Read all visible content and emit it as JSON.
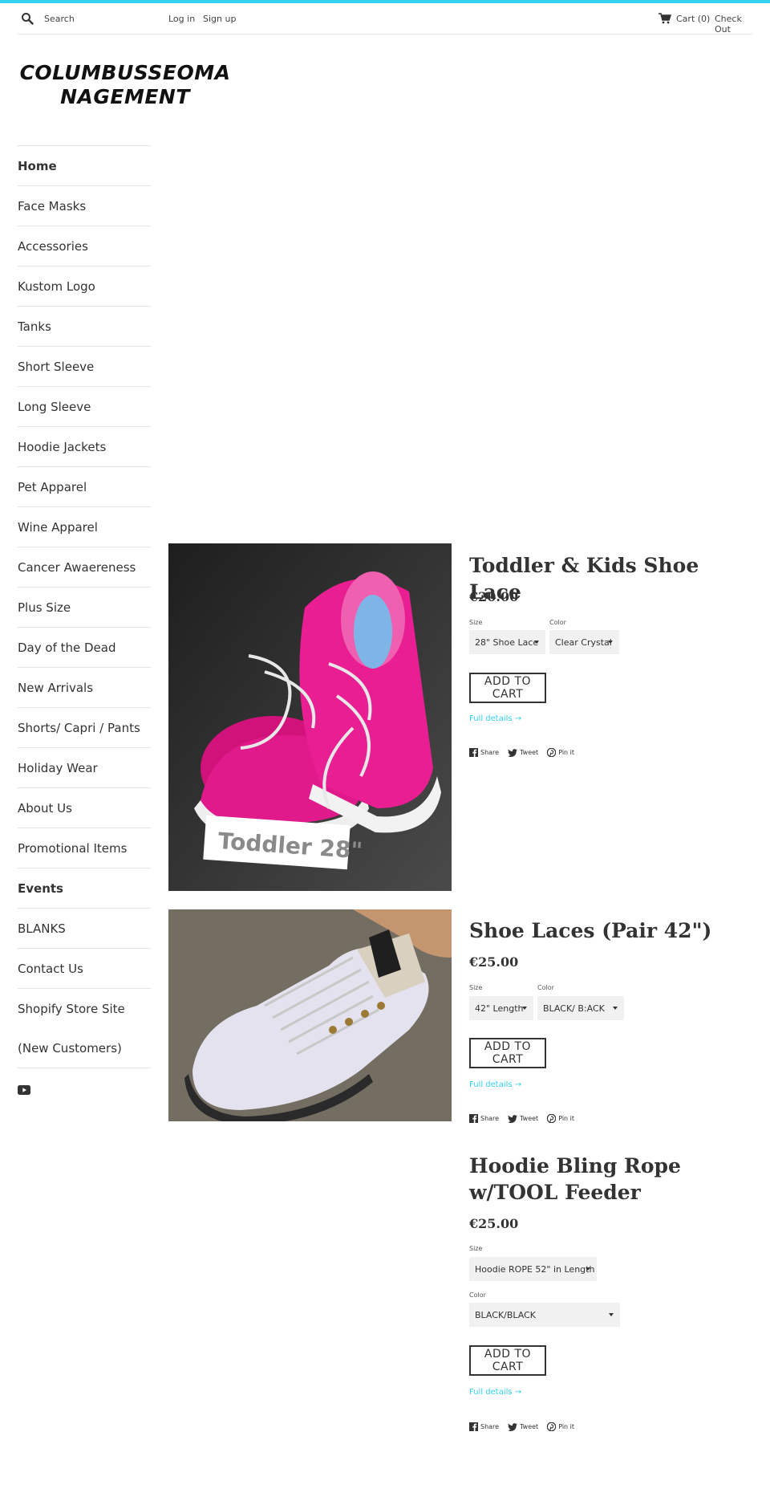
{
  "header": {
    "search_placeholder": "Search",
    "login": "Log in",
    "signup": "Sign up",
    "cart": "Cart (0)",
    "checkout": "Check Out"
  },
  "logo": {
    "line1": "COLUMBUSSEOMA",
    "line2": "NAGEMENT"
  },
  "nav": [
    "Home",
    "Face Masks",
    "Accessories",
    "Kustom Logo",
    "Tanks",
    "Short Sleeve",
    "Long Sleeve",
    "Hoodie Jackets",
    "Pet Apparel",
    "Wine Apparel",
    "Cancer Awaereness",
    "Plus Size",
    "Day of the Dead",
    "New Arrivals",
    "Shorts/ Capri / Pants",
    "Holiday Wear",
    "About Us",
    "Promotional Items",
    "Events",
    "BLANKS",
    "Contact Us",
    "Shopify Store Site",
    "(New Customers)"
  ],
  "products": [
    {
      "title": "Toddler & Kids Shoe Lace",
      "price": "€20.00",
      "image_text": "Toddler 28\"",
      "size_label": "Size",
      "size_value": "28\" Shoe Lace",
      "color_label": "Color",
      "color_value": "Clear Crystal",
      "cart": "ADD TO CART",
      "details": "Full details →"
    },
    {
      "title": "Shoe Laces (Pair 42\")",
      "price": "€25.00",
      "size_label": "Size",
      "size_value": "42\" Length",
      "color_label": "Color",
      "color_value": "BLACK/ B:ACK",
      "cart": "ADD TO CART",
      "details": "Full details →"
    },
    {
      "title": "Hoodie Bling Rope w/TOOL Feeder",
      "price": "€25.00",
      "size_label": "Size",
      "size_value": "Hoodie ROPE 52\" in Length",
      "color_label": "Color",
      "color_value": "BLACK/BLACK",
      "cart": "ADD TO CART",
      "details": "Full details →"
    }
  ],
  "share": {
    "share": "Share",
    "tweet": "Tweet",
    "pin": "Pin it"
  },
  "colors": {
    "accent": "#35d0ef",
    "text": "#333333",
    "select_bg": "#f1f1f1"
  }
}
